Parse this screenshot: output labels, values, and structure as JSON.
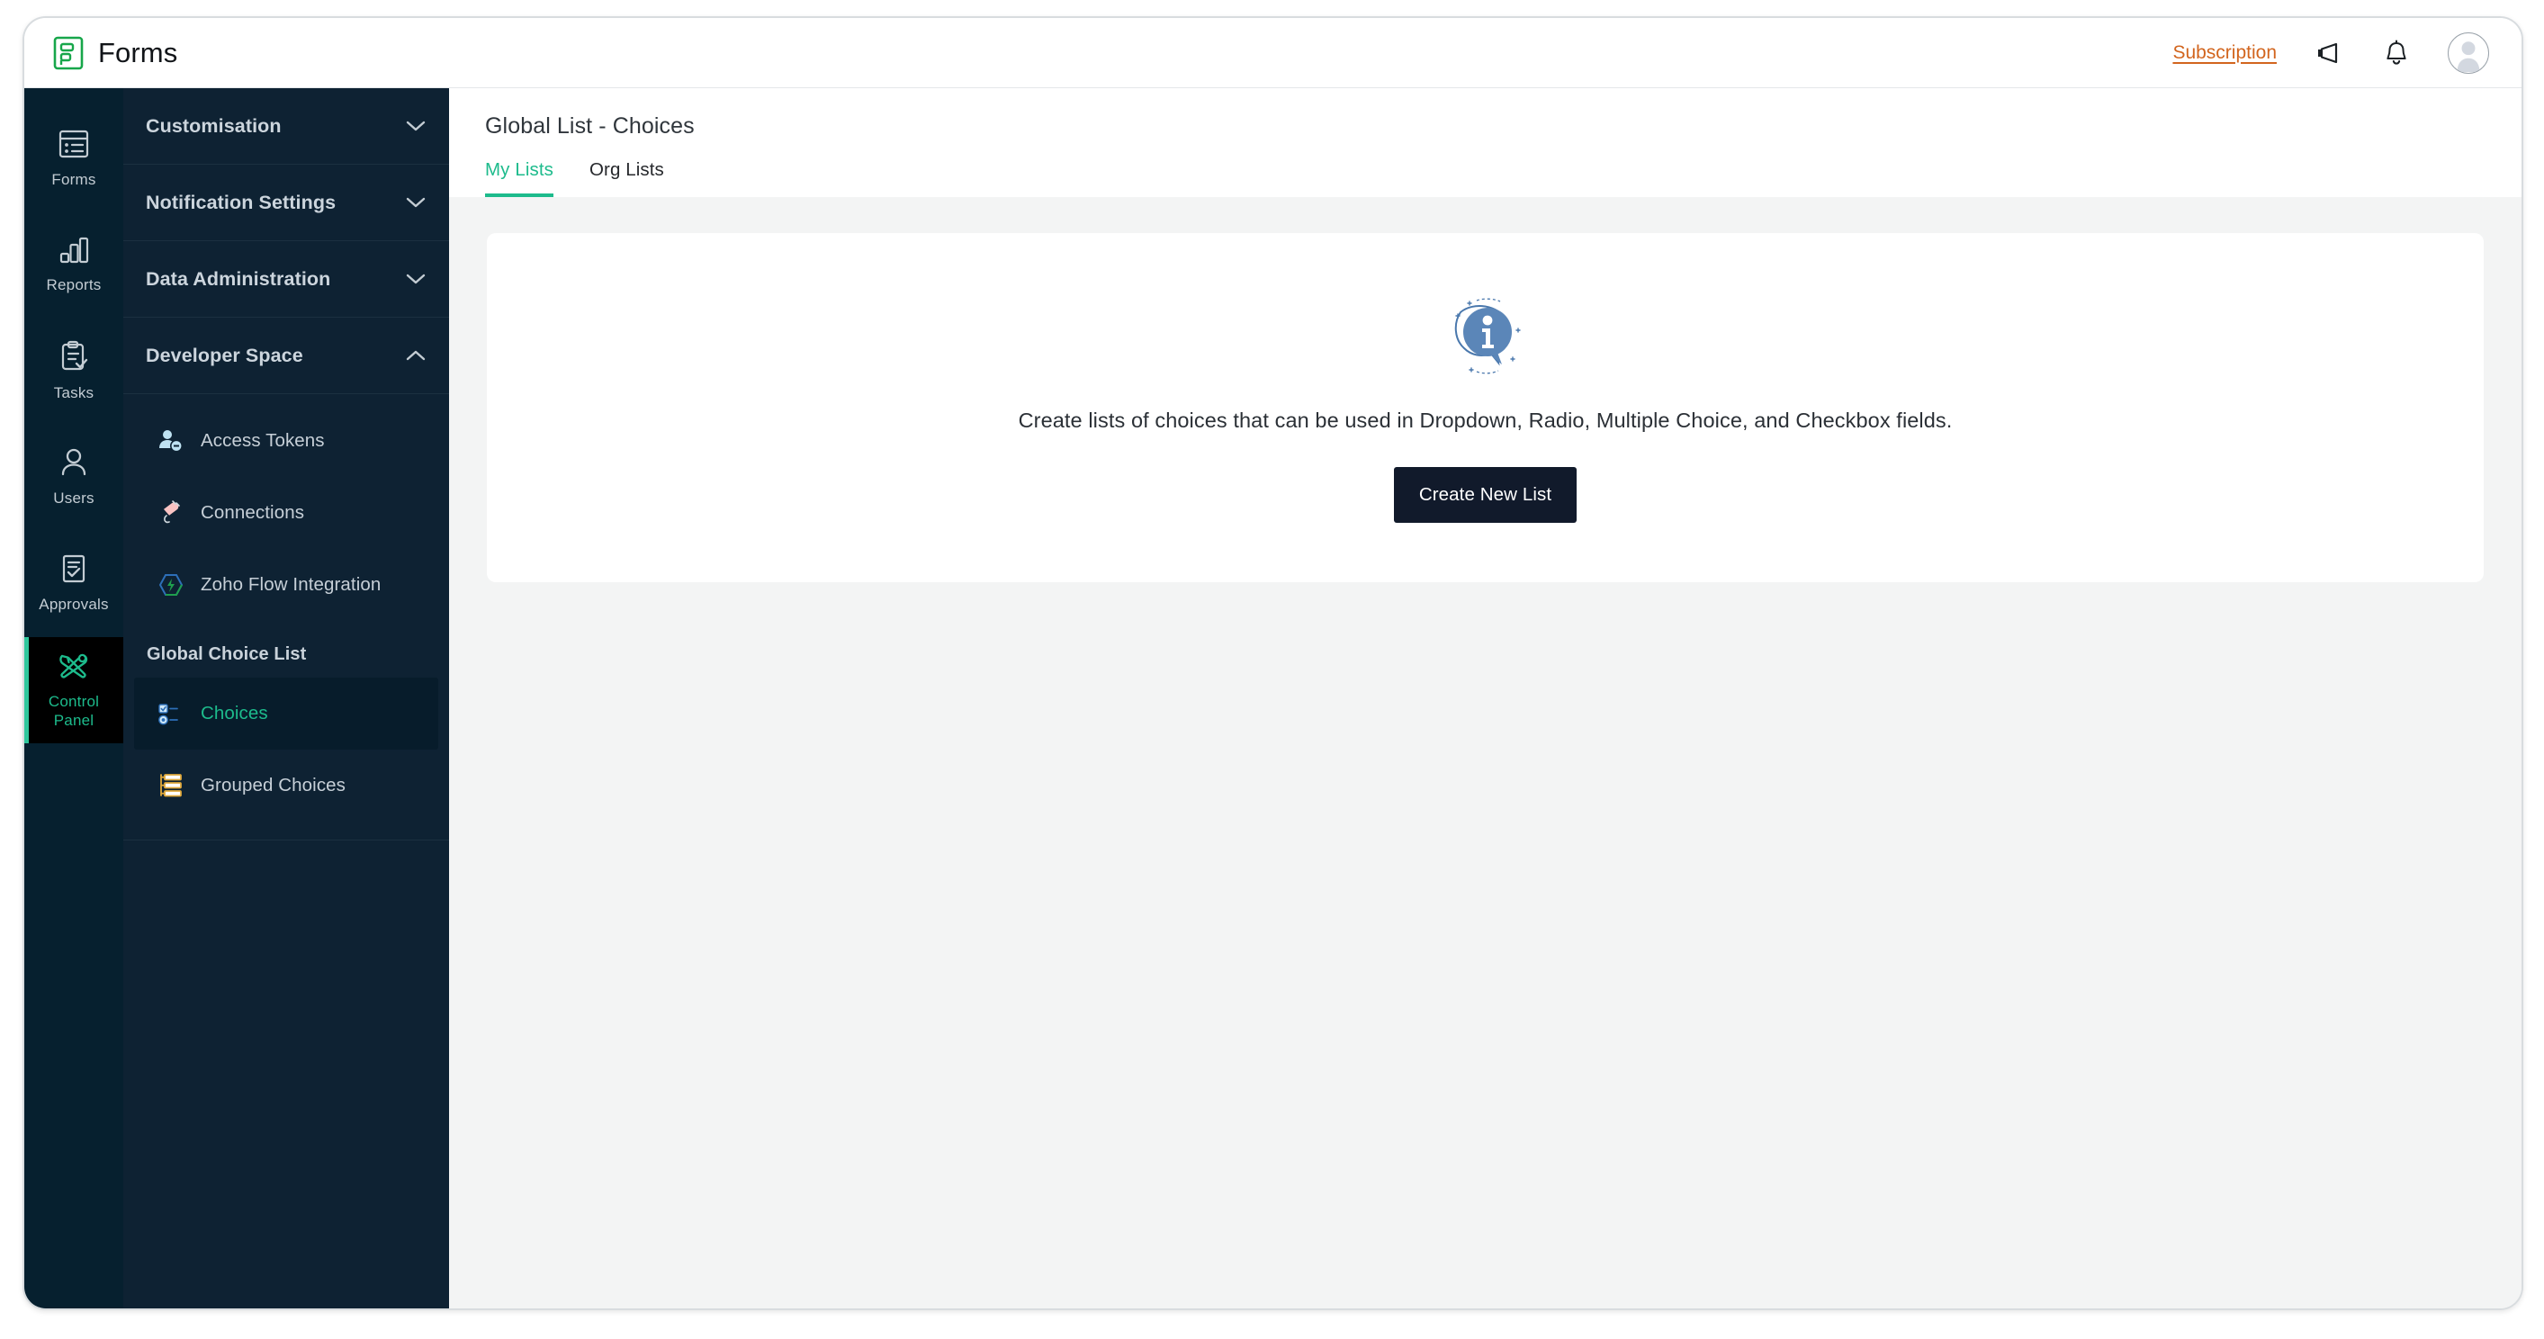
{
  "app": {
    "title": "Forms",
    "logo_icon": "forms-logo-icon"
  },
  "topbar": {
    "subscription_label": "Subscription",
    "announcement_icon": "megaphone-icon",
    "notification_icon": "bell-icon",
    "avatar_icon": "user-avatar-icon"
  },
  "icon_rail": {
    "items": [
      {
        "label": "Forms",
        "icon": "forms-icon",
        "active": false
      },
      {
        "label": "Reports",
        "icon": "bar-chart-icon",
        "active": false
      },
      {
        "label": "Tasks",
        "icon": "clipboard-check-icon",
        "active": false
      },
      {
        "label": "Users",
        "icon": "person-icon",
        "active": false
      },
      {
        "label": "Approvals",
        "icon": "approval-doc-icon",
        "active": false
      },
      {
        "label": "Control\nPanel",
        "icon": "tools-icon",
        "active": true
      }
    ]
  },
  "sidebar": {
    "accordions": [
      {
        "label": "Customisation",
        "icon": "chevron-down-icon",
        "expanded": false
      },
      {
        "label": "Notification Settings",
        "icon": "chevron-down-icon",
        "expanded": false
      },
      {
        "label": "Data Administration",
        "icon": "chevron-down-icon",
        "expanded": false
      },
      {
        "label": "Developer Space",
        "icon": "chevron-up-icon",
        "expanded": true
      }
    ],
    "developer_space": {
      "items": [
        {
          "label": "Access Tokens",
          "icon": "user-token-icon"
        },
        {
          "label": "Connections",
          "icon": "plug-icon"
        },
        {
          "label": "Zoho Flow Integration",
          "icon": "zoho-flow-icon"
        }
      ],
      "group_heading": "Global Choice List",
      "group_items": [
        {
          "label": "Choices",
          "icon": "choices-list-icon",
          "active": true
        },
        {
          "label": "Grouped Choices",
          "icon": "grouped-list-icon",
          "active": false
        }
      ]
    }
  },
  "main": {
    "page_title": "Global List - Choices",
    "tabs": [
      {
        "label": "My Lists",
        "active": true
      },
      {
        "label": "Org Lists",
        "active": false
      }
    ],
    "empty_state": {
      "icon": "info-bubble-icon",
      "message": "Create lists of choices that can be used in Dropdown, Radio, Multiple Choice, and Checkbox fields.",
      "button_label": "Create New List"
    }
  },
  "colors": {
    "accent_green": "#1dbb8c",
    "rail_bg": "#06202f",
    "sidebar_bg": "#0e2233",
    "active_rail_bg": "#000000",
    "subscription_orange": "#d2651e",
    "button_dark": "#111a2b",
    "page_bg": "#f3f4f4"
  }
}
